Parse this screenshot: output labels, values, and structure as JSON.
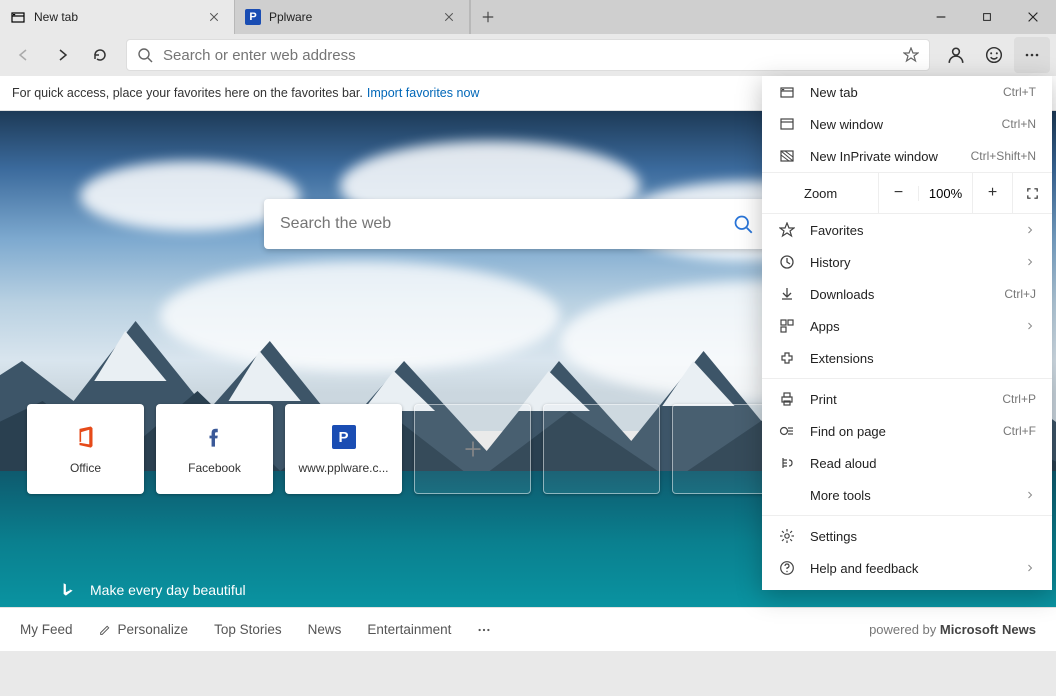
{
  "tabs": [
    {
      "label": "New tab",
      "icon": "newtab-icon"
    },
    {
      "label": "Pplware",
      "icon": "pplware-icon"
    }
  ],
  "addressbar": {
    "placeholder": "Search or enter web address"
  },
  "favoritesBar": {
    "hint": "For quick access, place your favorites here on the favorites bar.",
    "link": "Import favorites now"
  },
  "newTabPage": {
    "searchPlaceholder": "Search the web",
    "slogan": "Make every day beautiful",
    "tiles": [
      {
        "label": "Office",
        "icon": "office-icon"
      },
      {
        "label": "Facebook",
        "icon": "facebook-icon"
      },
      {
        "label": "www.pplware.c...",
        "icon": "pplware-icon"
      }
    ],
    "nav": {
      "items": [
        "My Feed",
        "Personalize",
        "Top Stories",
        "News",
        "Entertainment"
      ],
      "poweredPrefix": "powered by",
      "poweredBrand": "Microsoft News"
    }
  },
  "menu": {
    "zoomLabel": "Zoom",
    "zoomValue": "100%",
    "items1": [
      {
        "label": "New tab",
        "hint": "Ctrl+T",
        "icon": "newtab-icon"
      },
      {
        "label": "New window",
        "hint": "Ctrl+N",
        "icon": "window-icon"
      },
      {
        "label": "New InPrivate window",
        "hint": "Ctrl+Shift+N",
        "icon": "inprivate-icon"
      }
    ],
    "items2": [
      {
        "label": "Favorites",
        "chev": true,
        "icon": "star-icon"
      },
      {
        "label": "History",
        "chev": true,
        "icon": "history-icon"
      },
      {
        "label": "Downloads",
        "hint": "Ctrl+J",
        "icon": "download-icon"
      },
      {
        "label": "Apps",
        "chev": true,
        "icon": "apps-icon"
      },
      {
        "label": "Extensions",
        "icon": "extension-icon"
      }
    ],
    "items3": [
      {
        "label": "Print",
        "hint": "Ctrl+P",
        "icon": "print-icon"
      },
      {
        "label": "Find on page",
        "hint": "Ctrl+F",
        "icon": "find-icon"
      },
      {
        "label": "Read aloud",
        "icon": "readaloud-icon"
      },
      {
        "label": "More tools",
        "chev": true,
        "icon": ""
      }
    ],
    "items4": [
      {
        "label": "Settings",
        "icon": "settings-icon"
      },
      {
        "label": "Help and feedback",
        "chev": true,
        "icon": "help-icon"
      }
    ]
  }
}
